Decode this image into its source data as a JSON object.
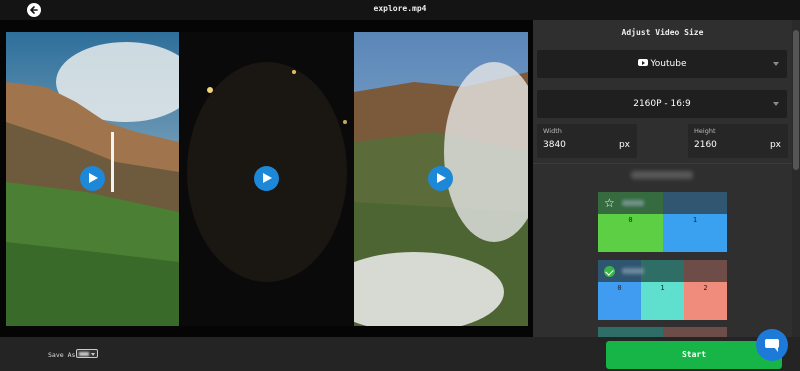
{
  "header": {
    "title": "explore.mp4"
  },
  "panel": {
    "title": "Adjust Video Size",
    "platform_select": {
      "value": "Youtube",
      "icon": "youtube-icon"
    },
    "resolution_select": {
      "value": "2160P - 16:9"
    },
    "width": {
      "label": "Width",
      "value": "3840",
      "unit": "px"
    },
    "height": {
      "label": "Height",
      "value": "2160",
      "unit": "px"
    },
    "presets": [
      {
        "icon": "star-icon",
        "cells": [
          "0",
          "1"
        ],
        "colors": [
          "#5dcf45",
          "#3aa0f0"
        ]
      },
      {
        "icon": "check-circle-icon",
        "cells": [
          "0",
          "1",
          "2"
        ],
        "colors": [
          "#3f9cf0",
          "#5fe0cf",
          "#f08c7c"
        ]
      }
    ]
  },
  "bottom": {
    "save_as_label": "Save As",
    "start_label": "Start"
  },
  "colors": {
    "accent_green": "#17b548",
    "accent_blue": "#1e88d8"
  }
}
